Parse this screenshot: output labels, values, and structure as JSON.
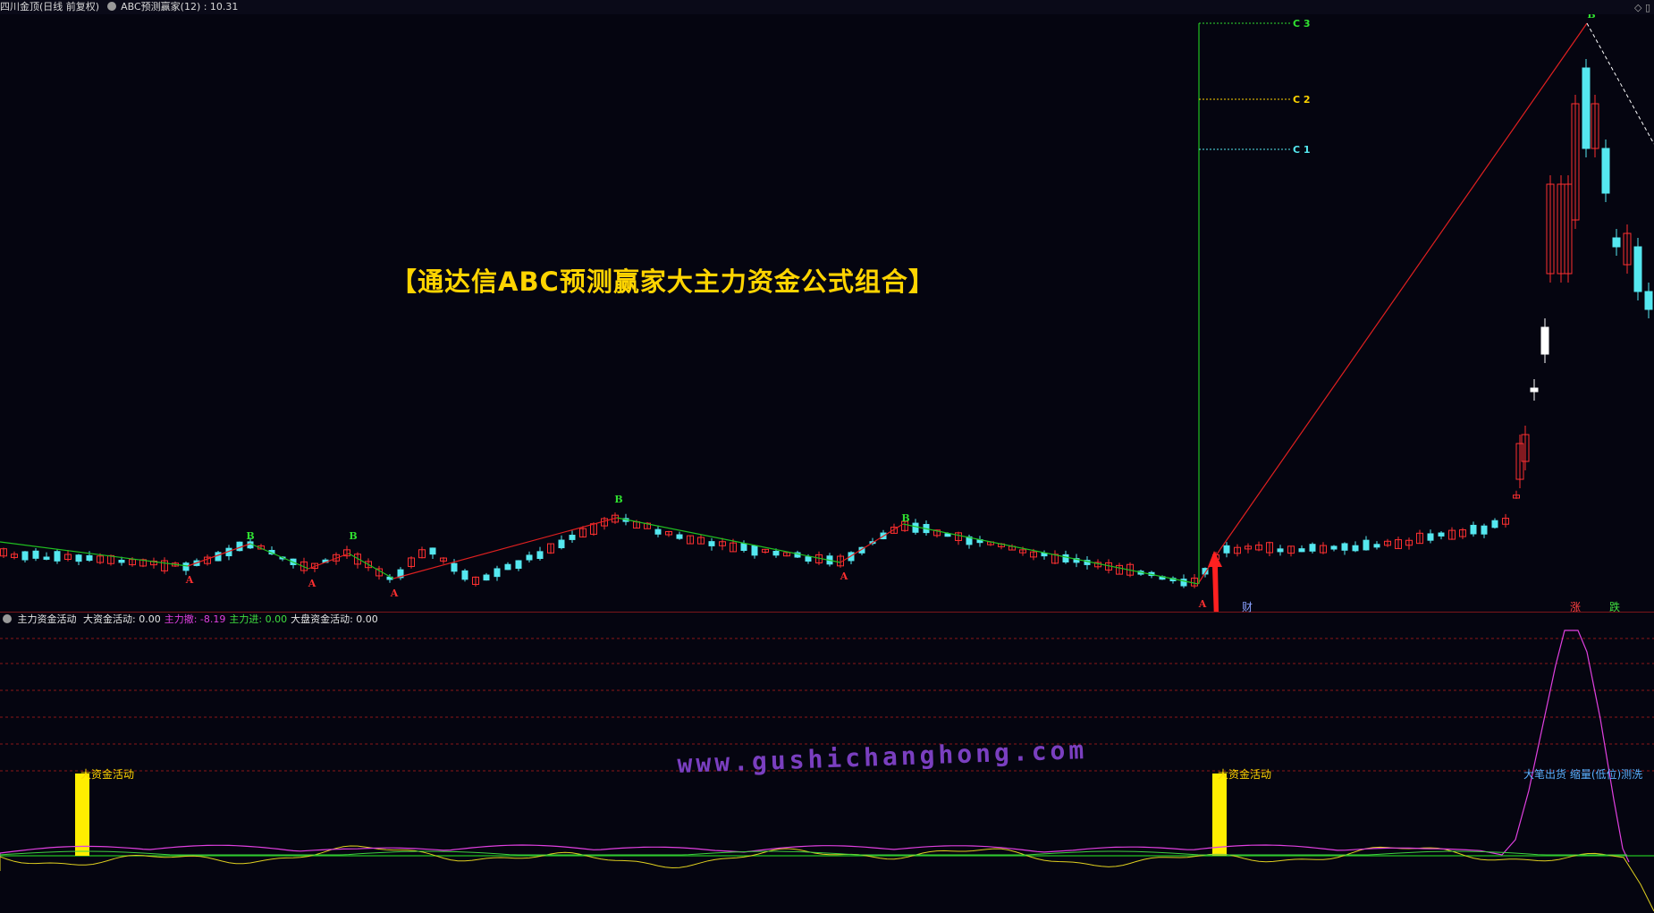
{
  "header": {
    "stock_title": "四川金顶(日线 前复权)",
    "indicator_title": "ABC预测赢家(12)",
    "indicator_value": ": 10.31",
    "controls": "◇ ▯"
  },
  "overlay": {
    "promo_title": "【通达信ABC预测赢家大主力资金公式组合】",
    "watermark": "www.gushichanghong.com"
  },
  "main_chart": {
    "wave_markers": [
      "A",
      "B",
      "C 1",
      "C 2",
      "C 3"
    ],
    "signal_cai": "财",
    "signal_zhang": "涨",
    "signal_die": "跌"
  },
  "sub_chart": {
    "indicator_name": "主力资金活动",
    "legend": [
      {
        "label": "大资金活动:",
        "value": "0.00",
        "color": "#e6e6e6"
      },
      {
        "label": "主力撤:",
        "value": "-8.19",
        "color": "#e040e0"
      },
      {
        "label": "主力进:",
        "value": "0.00",
        "color": "#40e040"
      },
      {
        "label": "大盘资金活动:",
        "value": "0.00",
        "color": "#e6e6e6"
      }
    ],
    "big_fund_label_1": "大资金活动",
    "big_fund_label_2": "大资金活动",
    "dump_label": "大笔出货 缩量(低位)测洗"
  },
  "colors": {
    "up": "#ff3030",
    "down": "#55e8f0",
    "wave_up": "#e02020",
    "wave_down": "#20c020",
    "yellow": "#ffd400",
    "magenta": "#e040e0"
  }
}
